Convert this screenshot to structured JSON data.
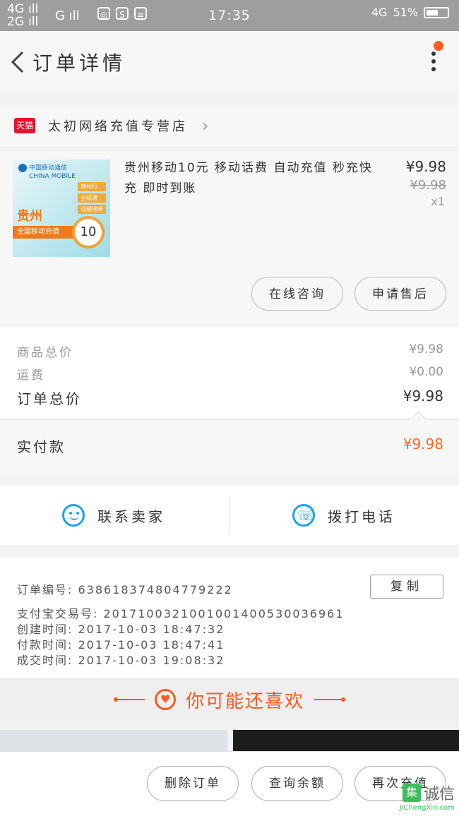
{
  "status_bar": {
    "net1": "4G",
    "net2": "2G",
    "net3": "G",
    "time": "17:35",
    "net4": "4G",
    "battery": "51%"
  },
  "header": {
    "title": "订单详情"
  },
  "store": {
    "badge": "天猫",
    "name": "太初网络充值专营店"
  },
  "product": {
    "thumb": {
      "brand": "中国移动通信",
      "brand_en": "CHINA MOBILE",
      "tags": [
        "神州行",
        "全球通",
        "动感地带"
      ],
      "province": "贵州",
      "banner": "全国移动充值",
      "amount": "10"
    },
    "name": "贵州移动10元 移动话费 自动充值 秒充快充 即时到账",
    "price": "¥9.98",
    "original_price": "¥9.98",
    "quantity": "x1",
    "btn_consult": "在线咨询",
    "btn_aftersale": "申请售后"
  },
  "summary": {
    "goods_label": "商品总价",
    "goods_value": "¥9.98",
    "shipping_label": "运费",
    "shipping_value": "¥0.00",
    "total_label": "订单总价",
    "total_value": "¥9.98",
    "paid_label": "实付款",
    "paid_value": "¥9.98"
  },
  "contact": {
    "seller": "联系卖家",
    "call": "拨打电话"
  },
  "order_info": {
    "order_no": "订单编号:  638618374804779222",
    "copy": "复制",
    "alipay_no": "支付宝交易号:  2017100321001001400530036961",
    "created": "创建时间:  2017-10-03  18:47:32",
    "paid": "付款时间:  2017-10-03  18:47:41",
    "done": "成交时间:  2017-10-03  19:08:32"
  },
  "recommend": {
    "title": "你可能还喜欢"
  },
  "actions": {
    "delete": "删除订单",
    "balance": "查询余额",
    "recharge": "再次充值"
  },
  "watermark": {
    "char": "集",
    "text": "诚信",
    "url": "JiChengXin.com"
  },
  "colors": {
    "accent": "#ff5a1f",
    "price_orange": "#ff6a1a",
    "icon_blue": "#1aa3e8",
    "status_bar": "#9e9e9e"
  }
}
